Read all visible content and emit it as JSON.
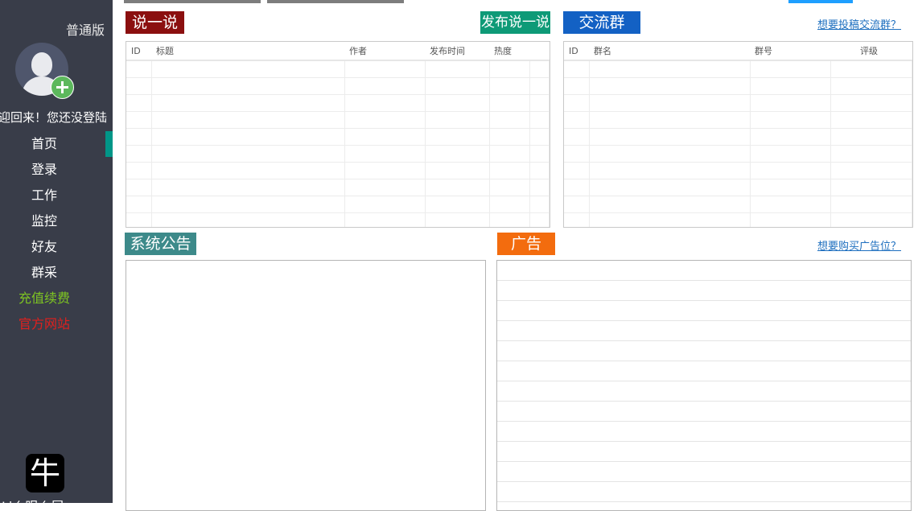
{
  "sidebar": {
    "edition": "普通版",
    "welcome": "迎回来！您还没登陆",
    "nav": [
      {
        "label": "首页",
        "color": "#ffffff"
      },
      {
        "label": "登录",
        "color": "#ffffff"
      },
      {
        "label": "工作",
        "color": "#ffffff"
      },
      {
        "label": "监控",
        "color": "#ffffff"
      },
      {
        "label": "好友",
        "color": "#ffffff"
      },
      {
        "label": "群采",
        "color": "#ffffff"
      },
      {
        "label": "充值续费",
        "color": "#7ec522"
      },
      {
        "label": "官方网站",
        "color": "#e0201e"
      }
    ],
    "logo_char": "牛",
    "footer": "Liㄠ眼ㄠ屏"
  },
  "posts": {
    "title": "说一说",
    "title_color": "#8b0f0f",
    "publish_button": "发布说一说",
    "publish_color": "#0e9a77",
    "columns": [
      "ID",
      "标题",
      "作者",
      "发布时间",
      "热度"
    ]
  },
  "groups": {
    "title": "交流群",
    "title_color": "#1361c4",
    "link": "想要投稿交流群？",
    "columns": [
      "ID",
      "群名",
      "群号",
      "评级"
    ]
  },
  "notice": {
    "title": "系统公告",
    "title_color": "#3d8a8a"
  },
  "ads": {
    "title": "广告",
    "title_color": "#f36c0e",
    "link": "想要购买广告位？"
  }
}
